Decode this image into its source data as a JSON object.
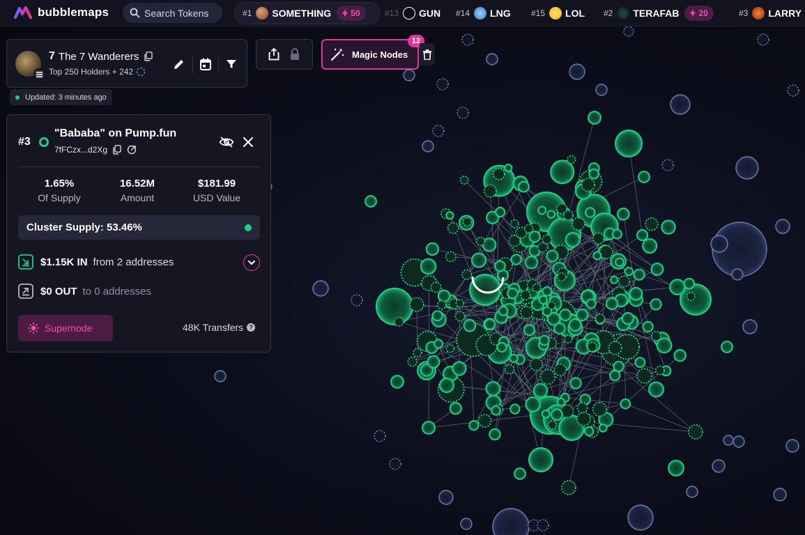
{
  "app": {
    "name": "bubblemaps",
    "brand_color": "#e2389c"
  },
  "search": {
    "label": "Search Tokens"
  },
  "ticker": [
    {
      "rank": "#1",
      "name": "SOMETHING",
      "boost": "50"
    },
    {
      "rank": "#13",
      "name": "GUN"
    },
    {
      "rank": "#14",
      "name": "LNG"
    },
    {
      "rank": "#15",
      "name": "LOL"
    },
    {
      "rank": "#2",
      "name": "TERAFAB",
      "boost": "20"
    },
    {
      "rank": "#3",
      "name": "LARRY"
    }
  ],
  "wallet": {
    "rank": "7",
    "name": "The 7 Wanderers",
    "subtitle": "Top 250 Holders + 242",
    "updated": "Updated: 3 minutes ago"
  },
  "toolbar": {
    "magic_nodes_label": "Magic Nodes",
    "magic_nodes_count": "12"
  },
  "detail": {
    "rank": "#3",
    "title": "\"Bababa\" on Pump.fun",
    "address": "7fFCzx...d2Xg",
    "stats": [
      {
        "value": "1.65%",
        "label": "Of Supply"
      },
      {
        "value": "16.52M",
        "label": "Amount"
      },
      {
        "value": "$181.99",
        "label": "USD Value"
      }
    ],
    "cluster_supply": "Cluster Supply: 53.46%",
    "inflow": {
      "amount": "$1.15K IN",
      "text": "from 2 addresses"
    },
    "outflow": {
      "amount": "$0 OUT",
      "text": "to 0 addresses"
    },
    "supernode_label": "Supernode",
    "transfers": "48K Transfers"
  },
  "colors": {
    "green": "#1ecf85",
    "pink": "#e2389c",
    "node_blue": "#6b7aa8"
  }
}
